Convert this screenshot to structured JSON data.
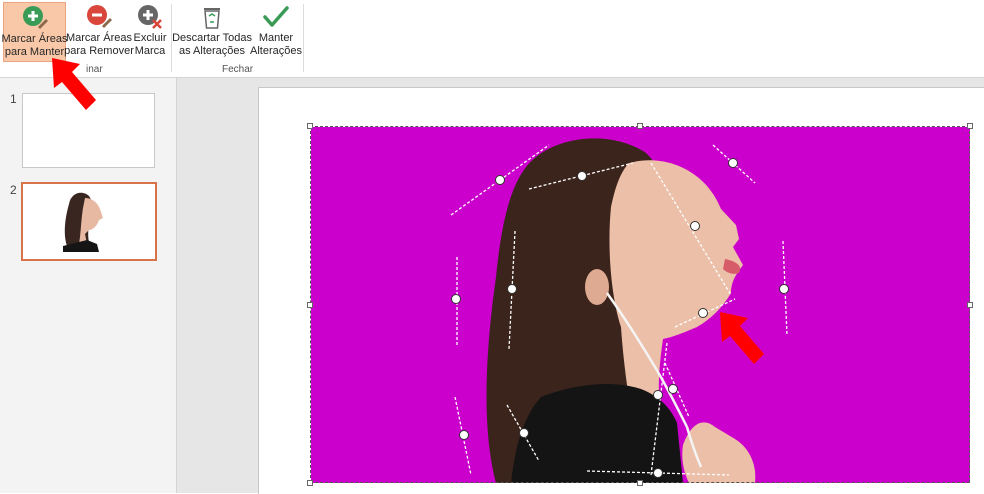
{
  "ribbon": {
    "buttons": {
      "mark_keep": "Marcar Áreas\npara Manter",
      "mark_remove": "Marcar Áreas\npara Remover",
      "delete_mark": "Excluir\nMarca",
      "discard_all": "Descartar Todas\nas Alterações",
      "keep_changes": "Manter\nAlterações"
    },
    "groups": {
      "refine_partial": "inar",
      "close": "Fechar"
    }
  },
  "slides": [
    {
      "number": "1"
    },
    {
      "number": "2"
    }
  ],
  "colors": {
    "removal_area": "#cc00cc",
    "active_button": "#f8c8a8",
    "selected_thumb_border": "#d9734a",
    "annotation_arrow": "#ff0000"
  },
  "icons": {
    "mark_keep": "plus-pencil-icon",
    "mark_remove": "minus-pencil-icon",
    "delete_mark": "plus-x-icon",
    "discard_all": "recycle-bin-icon",
    "keep_changes": "checkmark-icon"
  }
}
